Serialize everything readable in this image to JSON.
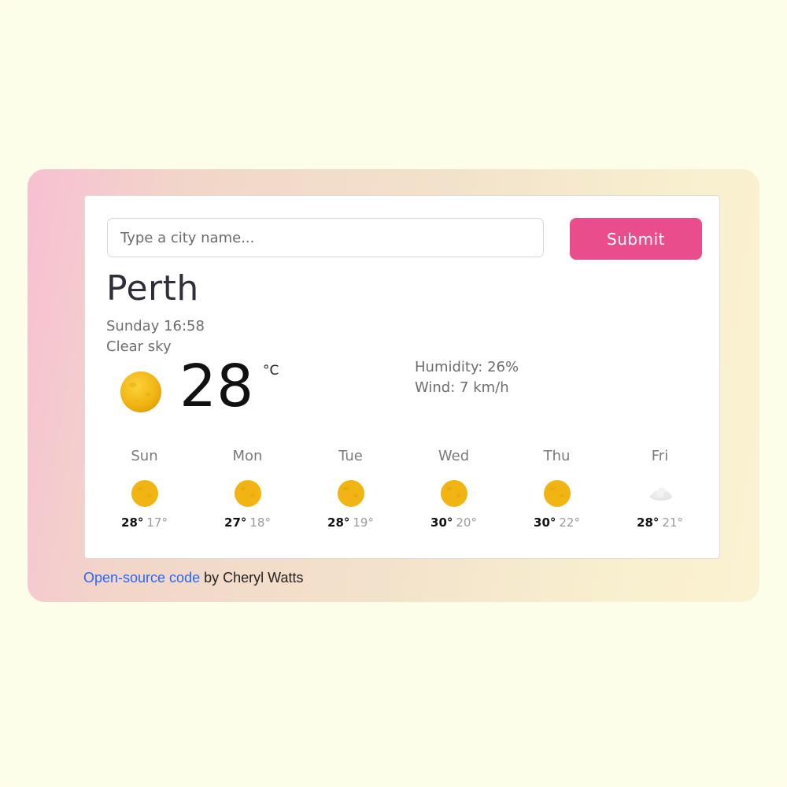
{
  "search": {
    "placeholder": "Type a city name...",
    "submit_label": "Submit"
  },
  "current": {
    "city": "Perth",
    "datetime": "Sunday 16:58",
    "description": "Clear sky",
    "temperature": "28",
    "unit": "°C",
    "humidity": "Humidity: 26%",
    "wind": "Wind: 7 km/h",
    "icon": "sun-icon"
  },
  "forecast": [
    {
      "day": "Sun",
      "max": "28°",
      "min": "17°",
      "icon": "sun-icon"
    },
    {
      "day": "Mon",
      "max": "27°",
      "min": "18°",
      "icon": "sun-icon"
    },
    {
      "day": "Tue",
      "max": "28°",
      "min": "19°",
      "icon": "sun-icon"
    },
    {
      "day": "Wed",
      "max": "30°",
      "min": "20°",
      "icon": "sun-icon"
    },
    {
      "day": "Thu",
      "max": "30°",
      "min": "22°",
      "icon": "sun-icon"
    },
    {
      "day": "Fri",
      "max": "28°",
      "min": "21°",
      "icon": "cloud-icon"
    }
  ],
  "footer": {
    "link_text": "Open-source code",
    "author_text": " by Cheryl Watts"
  },
  "colors": {
    "accent": "#e94d8c",
    "link": "#2767f5",
    "sun": "#f0b414"
  }
}
